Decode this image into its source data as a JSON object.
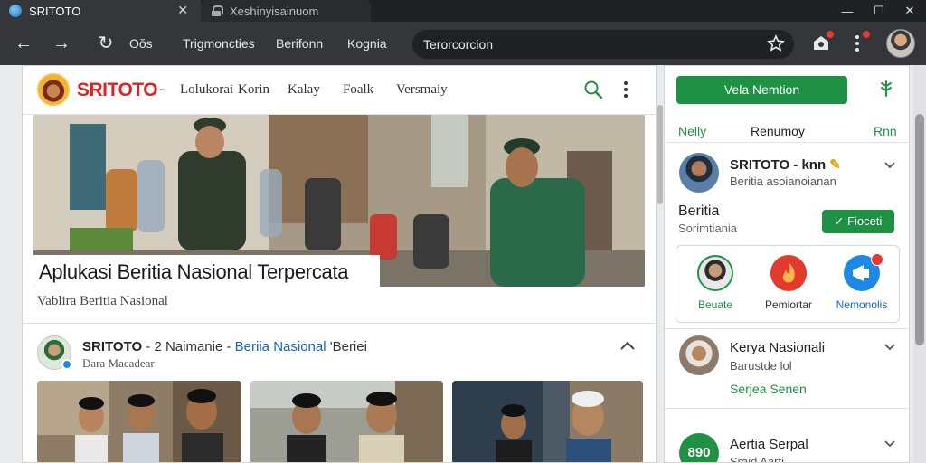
{
  "browser": {
    "active_tab": "SRITOTO",
    "inactive_tab": "Xeshinyisainuom",
    "bookmarks": [
      "Oŏs",
      "Trigmoncties",
      "Berifonn",
      "Kognia"
    ],
    "address": "Terorcorcion"
  },
  "site": {
    "name": "SRITOTO",
    "name_dash": "-",
    "nav": [
      "Lolukorai",
      "Korin",
      "Kalay",
      "Foalk",
      "Versmaiy"
    ]
  },
  "hero": {
    "title": "Aplukasi Beritia Nasional Terpercata",
    "subtitle": "Vablira Beritia Nasional"
  },
  "post": {
    "author": "SRITOTO",
    "sep1": " - 2 Naimanie ",
    "sep2": "- ",
    "category": "Beriia Nasional",
    "extra": " 'Beriei",
    "sub": "Dara Macadear"
  },
  "sidebar": {
    "cta": "Vela Nemtion",
    "tabs": [
      "Nelly",
      "Renumoy",
      "Rnn"
    ],
    "profile": {
      "title": "SRITOTO - knn",
      "subtitle": "Beritia asoianoianan"
    },
    "section_title": "Beritia",
    "section_sub": "Sorimtiania",
    "follow": "✓ Fioceti",
    "quick": [
      "Beuate",
      "Pemiortar",
      "Nemonolis"
    ],
    "cards": [
      {
        "title": "Kerya Nasionali",
        "sub": "Barustde lol",
        "tag": "Serjea Senen"
      },
      {
        "title": "Aertia Serpal",
        "sub": "Sraid Aarti",
        "avatar_text": "890"
      }
    ]
  },
  "colors": {
    "brand_red": "#d62525",
    "accent_green": "#1f9145",
    "link_blue": "#1565c0"
  }
}
